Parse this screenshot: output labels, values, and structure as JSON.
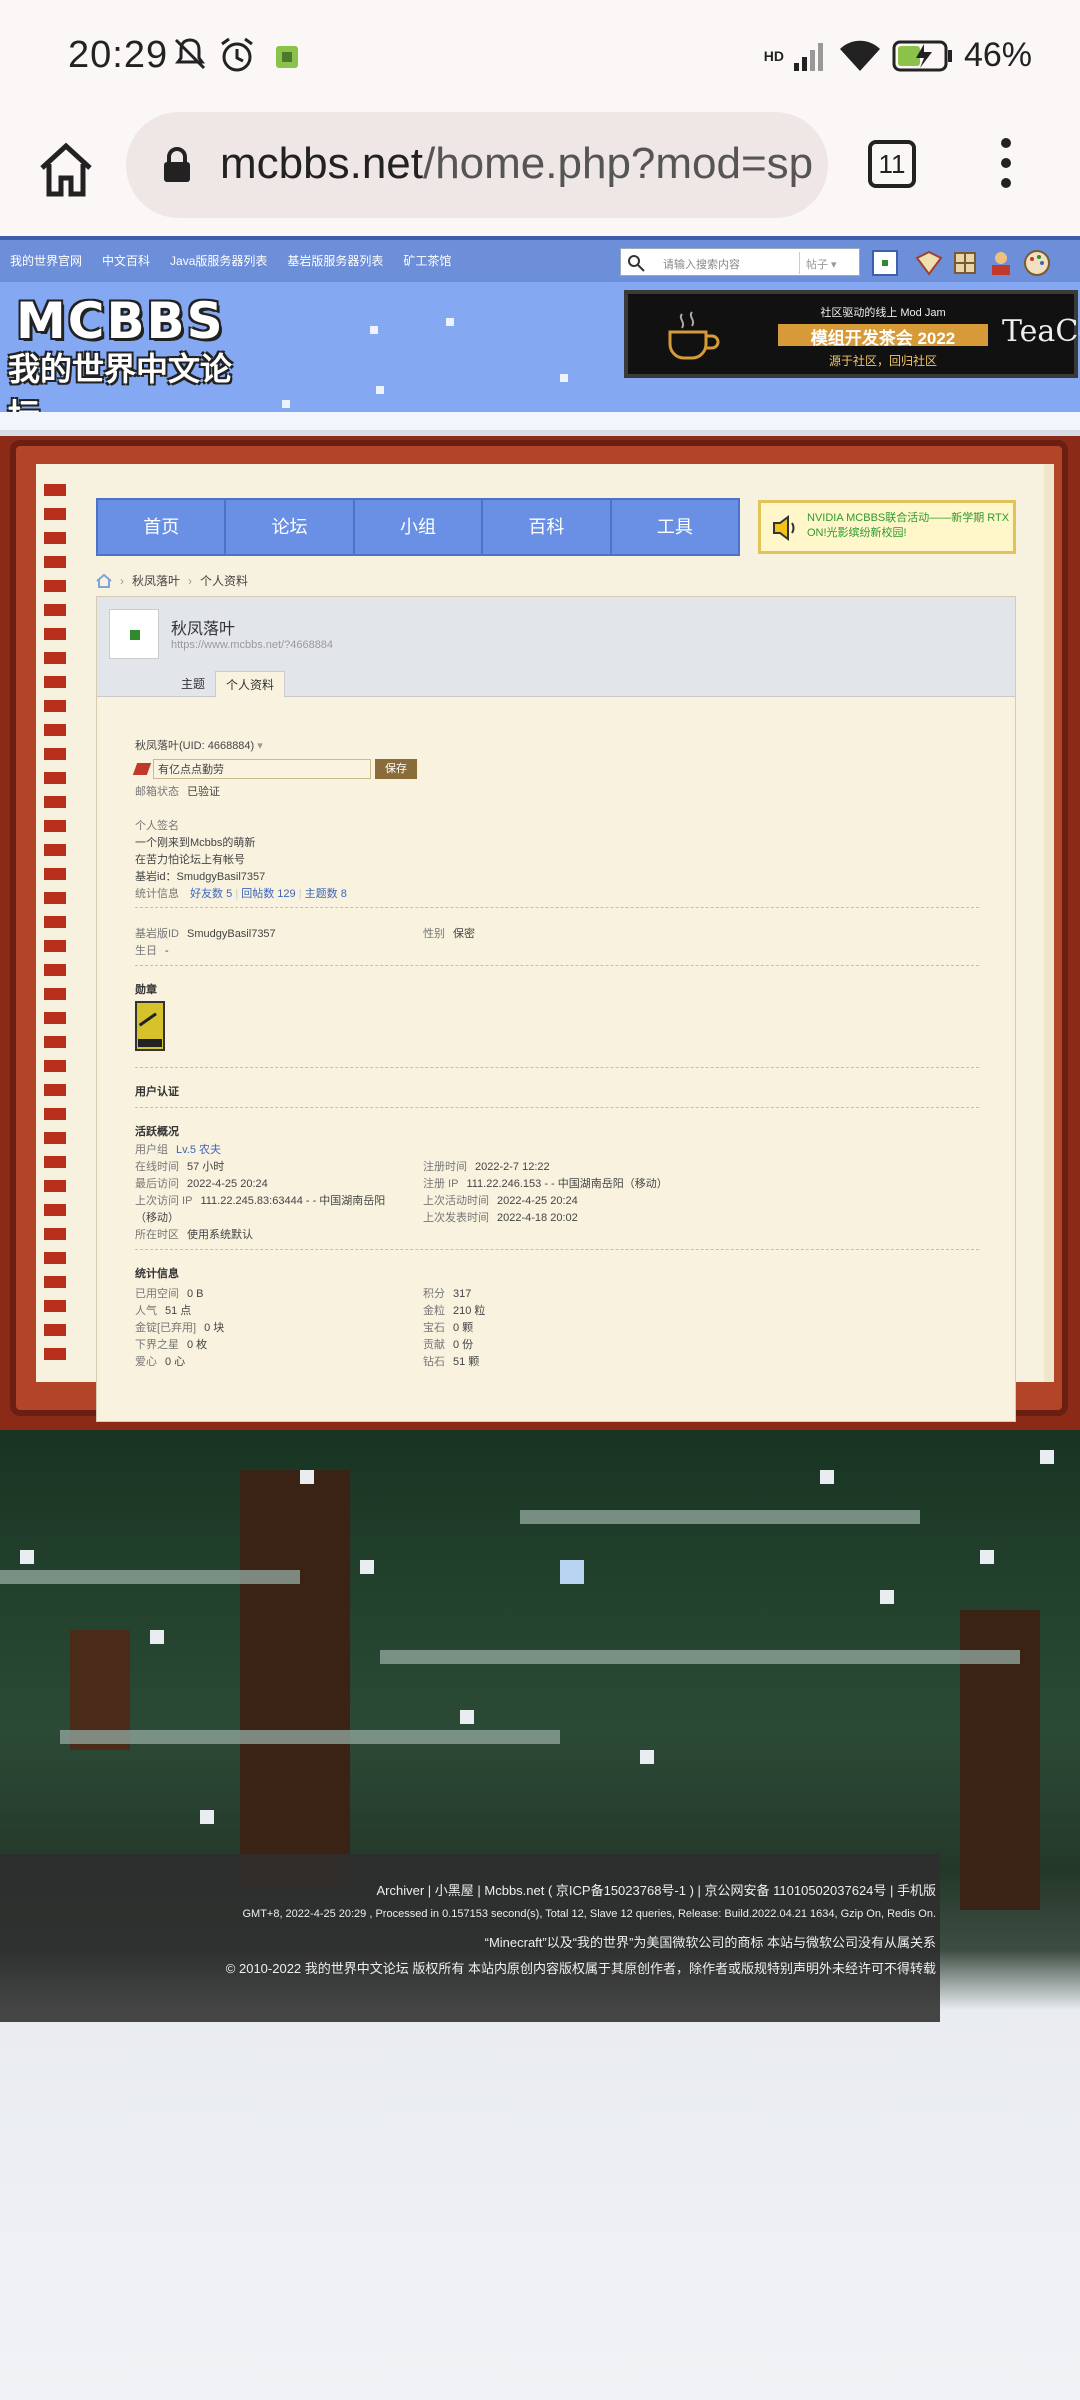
{
  "status_bar": {
    "time": "20:29",
    "battery": "46%",
    "network": "HD",
    "icons": [
      "mute-bell-icon",
      "alarm-icon",
      "app-notification-icon",
      "signal-icon",
      "wifi-icon",
      "battery-charging-icon"
    ]
  },
  "browser": {
    "url_domain": "mcbbs.net",
    "url_path": "/home.php?mod=sp",
    "tab_count": "11"
  },
  "site_nav": {
    "links": [
      "我的世界官网",
      "中文百科",
      "Java版服务器列表",
      "基岩版服务器列表",
      "矿工茶馆"
    ],
    "search_placeholder": "请输入搜索内容",
    "search_type": "帖子"
  },
  "banner": {
    "logo_top": "MCBBS",
    "logo_bottom": "我的世界中文论坛",
    "ad_line1": "社区驱动的线上 Mod Jam",
    "ad_line2": "模组开发茶会 2022",
    "ad_line3": "源于社区，回归社区",
    "ad_brand": "TeaCon"
  },
  "main_nav": {
    "tabs": [
      "首页",
      "论坛",
      "小组",
      "百科",
      "工具"
    ]
  },
  "notice": {
    "text": "NVIDIA MCBBS联合活动——新学期 RTX ON!光影缤纷新校园!"
  },
  "breadcrumb": [
    "秋凤落叶",
    "个人资料"
  ],
  "profile": {
    "name": "秋凤落叶",
    "url": "https://www.mcbbs.net/?4668884",
    "tabs": [
      "主题",
      "个人资料"
    ],
    "active_tab": "个人资料",
    "uid_line": "秋凤落叶(UID: 4668884)",
    "sign_value": "有亿点点勤劳",
    "save_label": "保存",
    "email_label": "邮箱状态",
    "email_value": "已验证",
    "signature_label": "个人签名",
    "signature_lines": [
      "一个刚来到Mcbbs的萌新",
      "在苦力怕论坛上有帐号",
      "基岩id：SmudgyBasil7357"
    ],
    "stats_label": "统计信息",
    "stats_friends": "好友数 5",
    "stats_replies": "回帖数 129",
    "stats_threads": "主题数 8",
    "bedrock_label": "基岩版ID",
    "bedrock_value": "SmudgyBasil7357",
    "gender_label": "性别",
    "gender_value": "保密",
    "birthday_label": "生日",
    "birthday_value": "-",
    "medals_title": "勋章",
    "auth_title": "用户认证",
    "activity_title": "活跃概况",
    "group_label": "用户组",
    "group_value": "Lv.5 农夫",
    "online_label": "在线时间",
    "online_value": "57 小时",
    "reg_time_label": "注册时间",
    "reg_time_value": "2022-2-7 12:22",
    "last_visit_label": "最后访问",
    "last_visit_value": "2022-4-25 20:24",
    "reg_ip_label": "注册 IP",
    "reg_ip_value": "111.22.246.153 - - 中国湖南岳阳（移动）",
    "last_ip_label": "上次访问 IP",
    "last_ip_value": "111.22.245.83:63444 - - 中国湖南岳阳",
    "last_ip_value2": "（移动）",
    "last_active_label": "上次活动时间",
    "last_active_value": "2022-4-25 20:24",
    "last_post_label": "上次发表时间",
    "last_post_value": "2022-4-18 20:02",
    "tz_label": "所在时区",
    "tz_value": "使用系统默认",
    "stat_title": "统计信息",
    "used_space_label": "已用空间",
    "used_space_value": "0 B",
    "points_label": "积分",
    "points_value": "317",
    "popularity_label": "人气",
    "popularity_value": "51 点",
    "gold_label": "金粒",
    "gold_value": "210 粒",
    "ingot_label": "金锭[已弃用]",
    "ingot_value": "0 块",
    "gem_label": "宝石",
    "gem_value": "0 颗",
    "nether_label": "下界之星",
    "nether_value": "0 枚",
    "contrib_label": "贡献",
    "contrib_value": "0 份",
    "love_label": "爱心",
    "love_value": "0 心",
    "diamond_label": "钻石",
    "diamond_value": "51 颗"
  },
  "footer": {
    "line1": "Archiver | 小黑屋 | Mcbbs.net ( 京ICP备15023768号-1 ) | 京公网安备 11010502037624号 | 手机版",
    "line2": "GMT+8, 2022-4-25 20:29 , Processed in 0.157153 second(s), Total 12, Slave 12 queries, Release: Build.2022.04.21 1634, Gzip On, Redis On.",
    "line3": "“Minecraft”以及“我的世界”为美国微软公司的商标 本站与微软公司没有从属关系",
    "line4": "© 2010-2022 我的世界中文论坛 版权所有 本站内原创内容版权属于其原创作者，除作者或版规特别声明外未经许可不得转载"
  }
}
